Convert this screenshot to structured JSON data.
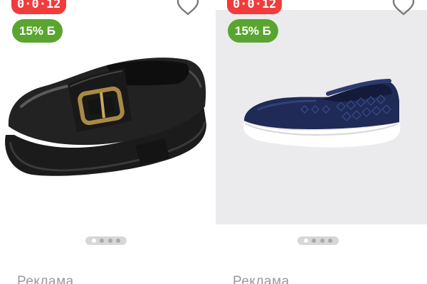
{
  "cards": [
    {
      "timer": "0·0·12",
      "discount": "15% Б",
      "ad_label": "Реклама",
      "slide_count": 4,
      "active_slide": 1
    },
    {
      "timer": "0·0·12",
      "discount": "15% Б",
      "ad_label": "Реклама",
      "slide_count": 4,
      "active_slide": 1
    }
  ],
  "colors": {
    "timer_badge": "#f23b3b",
    "discount_badge": "#5aa52f",
    "card_right_bg": "#ebebed",
    "ad_label_text": "#9a9a9a"
  },
  "icons": {
    "favorite": "heart-outline-icon",
    "product_left": "black-leather-loafer-with-buckle",
    "product_right": "navy-knit-mary-jane-flat"
  }
}
